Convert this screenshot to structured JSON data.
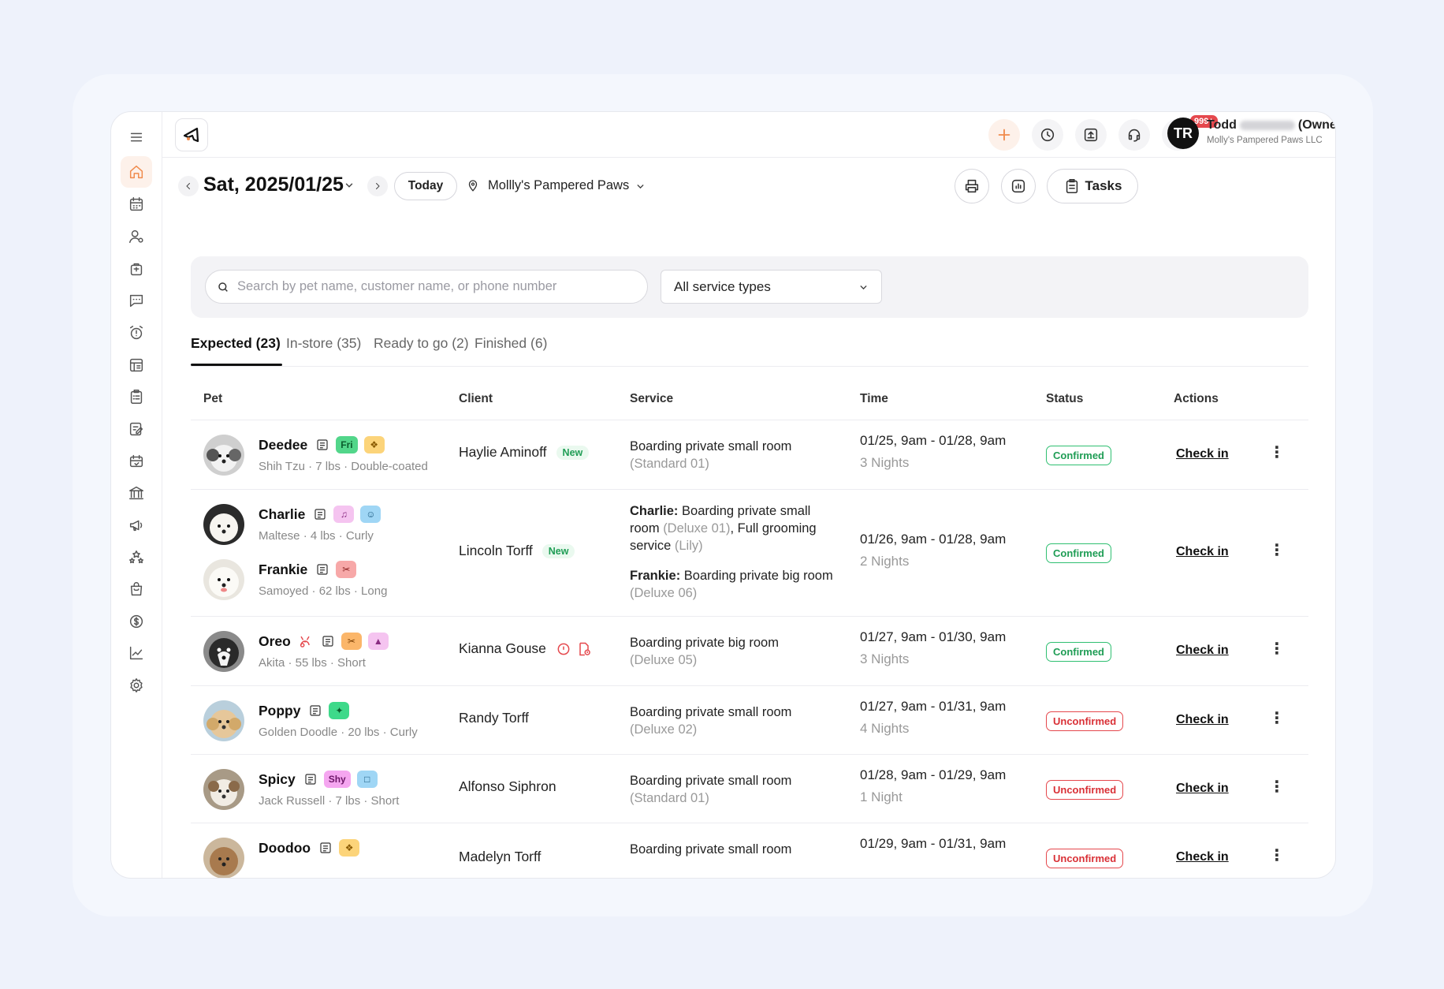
{
  "user": {
    "initials": "TR",
    "name_first": "Todd",
    "name_suffix": "(Owner)",
    "company": "Molly's Pampered Paws LLC"
  },
  "notifications": {
    "count": "999+"
  },
  "date_nav": {
    "date": "Sat, 2025/01/25",
    "today_label": "Today",
    "location": "Mollly's Pampered Paws",
    "tasks_label": "Tasks"
  },
  "filters": {
    "search_placeholder": "Search by pet name, customer name, or phone number",
    "service_type": "All service types"
  },
  "tabs": [
    {
      "label": "Expected (23)"
    },
    {
      "label": "In-store (35)"
    },
    {
      "label": "Ready to go (2)"
    },
    {
      "label": "Finished (6)"
    }
  ],
  "columns": {
    "pet": "Pet",
    "client": "Client",
    "service": "Service",
    "time": "Time",
    "status": "Status",
    "actions": "Actions"
  },
  "rows": [
    {
      "pets": [
        {
          "name": "Deedee",
          "info": "Shih Tzu · 7 lbs · Double-coated",
          "tags": [
            {
              "text": "Fri",
              "bg": "#52d68a",
              "fg": "#0b5c2d"
            },
            {
              "text": "❖",
              "bg": "#fcd47a",
              "fg": "#8a5a00"
            }
          ]
        }
      ],
      "client": "Haylie Aminoff",
      "client_new": "New",
      "service_main": "Boarding private small room",
      "service_room": "(Standard 01)",
      "time": "01/25, 9am - 01/28, 9am",
      "nights": "3 Nights",
      "status": "Confirmed",
      "action": "Check in"
    },
    {
      "pets": [
        {
          "name": "Charlie",
          "info": "Maltese · 4 lbs · Curly",
          "tags": [
            {
              "text": "♫",
              "bg": "#f5c4f0",
              "fg": "#8a2c82"
            },
            {
              "text": "☺",
              "bg": "#9fd6f5",
              "fg": "#1a5a80"
            }
          ]
        },
        {
          "name": "Frankie",
          "info": "Samoyed · 62 lbs · Long",
          "tags": [
            {
              "text": "✂",
              "bg": "#f7a8a8",
              "fg": "#8a1f1f"
            }
          ]
        }
      ],
      "client": "Lincoln Torff",
      "client_new": "New",
      "s1_name": "Charlie:",
      "s1_text": "Boarding private small room",
      "s1_room": "(Deluxe 01)",
      "s1_extra": ", Full grooming service",
      "s1_staff": "(Lily)",
      "s2_name": "Frankie:",
      "s2_text": "Boarding private big room",
      "s2_room": "(Deluxe 06)",
      "time": "01/26, 9am - 01/28, 9am",
      "nights": "2 Nights",
      "status": "Confirmed",
      "action": "Check in"
    },
    {
      "pets": [
        {
          "name": "Oreo",
          "info": "Akita · 55 lbs · Short",
          "tags": [
            {
              "text": "✂",
              "bg": "#fbb66a",
              "fg": "#7a3d00"
            },
            {
              "text": "▲",
              "bg": "#f5c4f0",
              "fg": "#8a2c82"
            }
          ]
        }
      ],
      "client": "Kianna Gouse",
      "service_main": "Boarding private big room",
      "service_room": "(Deluxe 05)",
      "time": "01/27, 9am - 01/30, 9am",
      "nights": "3 Nights",
      "status": "Confirmed",
      "action": "Check in"
    },
    {
      "pets": [
        {
          "name": "Poppy",
          "info": "Golden Doodle · 20 lbs · Curly",
          "tags": [
            {
              "text": "✦",
              "bg": "#3ed98a",
              "fg": "#0b5c2d"
            }
          ]
        }
      ],
      "client": "Randy Torff",
      "service_main": "Boarding private small room",
      "service_room": "(Deluxe 02)",
      "time": "01/27, 9am - 01/31, 9am",
      "nights": "4 Nights",
      "status": "Unconfirmed",
      "action": "Check in"
    },
    {
      "pets": [
        {
          "name": "Spicy",
          "info": "Jack Russell · 7 lbs · Short",
          "tags": [
            {
              "text": "Shy",
              "bg": "#f5a6f0",
              "fg": "#6e1668"
            },
            {
              "text": "□",
              "bg": "#9fd6f5",
              "fg": "#1a5a80"
            }
          ]
        }
      ],
      "client": "Alfonso Siphron",
      "service_main": "Boarding private small room",
      "service_room": "(Standard 01)",
      "time": "01/28, 9am - 01/29, 9am",
      "nights": "1 Night",
      "status": "Unconfirmed",
      "action": "Check in"
    },
    {
      "pets": [
        {
          "name": "Doodoo",
          "info": "",
          "tags": [
            {
              "text": "❖",
              "bg": "#fcd47a",
              "fg": "#8a5a00"
            }
          ]
        }
      ],
      "client": "Madelyn Torff",
      "service_main": "Boarding private small room",
      "service_room": "",
      "time": "01/29, 9am - 01/31, 9am",
      "nights": "",
      "status": "Unconfirmed",
      "action": "Check in"
    }
  ]
}
